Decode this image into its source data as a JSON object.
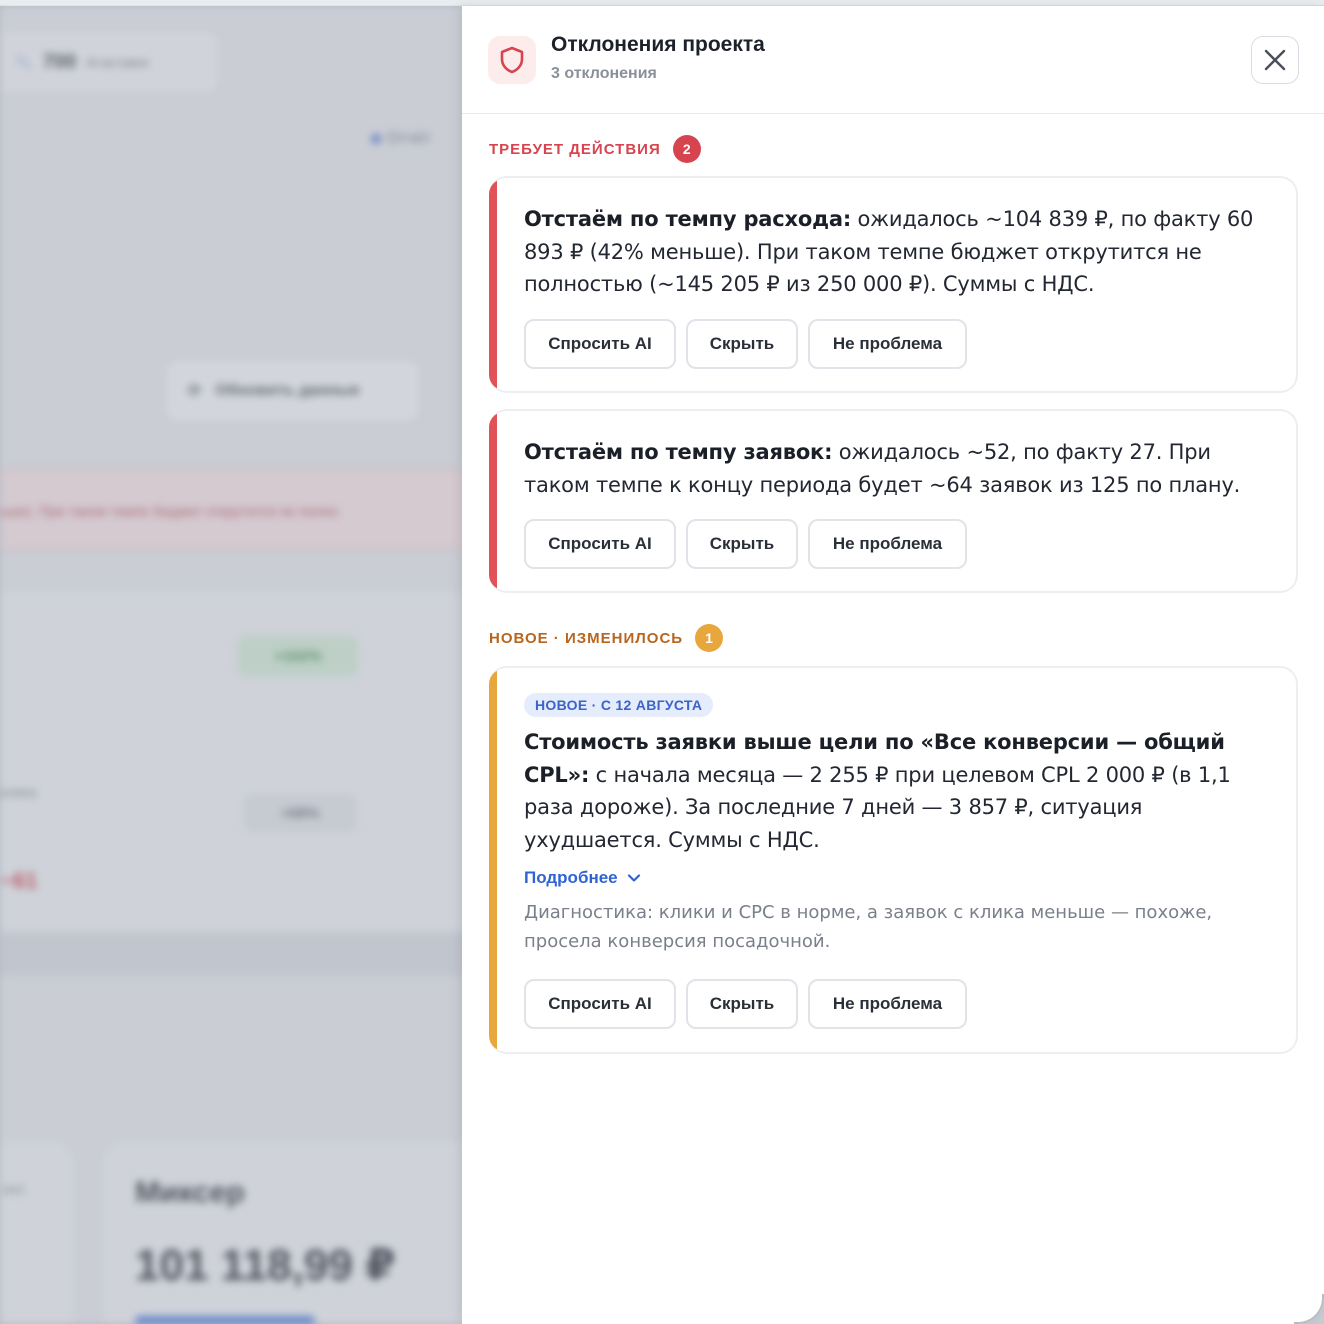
{
  "background": {
    "pill_number": "700",
    "pill_text": "AI-вставок",
    "report_text": "Отчёт",
    "refresh_label": "Обновить данные",
    "alert_text": "ьше). При таком темпе бюджет открутится не полно",
    "green_badge": "+102%",
    "grey_badge": "+68%",
    "small_text": "клика",
    "red_value": "−61",
    "card_sub": "ент.",
    "card_title": "Миксер",
    "card_amount": "101 118,99 ₽"
  },
  "drawer": {
    "title": "Отклонения проекта",
    "subtitle": "3 отклонения",
    "close_icon": "close-icon",
    "sections": [
      {
        "label": "ТРЕБУЕТ ДЕЙСТВИЯ",
        "count": "2",
        "color": "#d6454f"
      },
      {
        "label": "НОВОЕ · ИЗМЕНИЛОСЬ",
        "count": "1",
        "color": "#b8661f"
      }
    ],
    "cards": [
      {
        "bold": "Отстаём по темпу расхода:",
        "text": " ожидалось ~104 839 ₽, по факту 60 893 ₽ (42% меньше). При таком темпе бюджет открутится не полностью (~145 205 ₽ из 250 000 ₽). Суммы с НДС.",
        "stripe": "#e05258"
      },
      {
        "bold": "Отстаём по темпу заявок:",
        "text": " ожидалось ~52, по факту 27. При таком темпе к концу периода будет ~64 заявок из 125 по плану.",
        "stripe": "#e05258"
      },
      {
        "tag": "НОВОЕ · С 12 АВГУСТА",
        "bold": "Стоимость заявки выше цели по «Все конверсии — общий CPL»:",
        "text": " с начала месяца — 2 255 ₽ при целевом CPL 2 000 ₽ (в 1,1 раза дороже). За последние 7 дней — 3 857 ₽, ситуация ухудшается. Суммы с НДС.",
        "more": "Подробнее",
        "diagnostic": "Диагностика: клики и CPC в норме, а заявок с клика меньше — похоже, просела конверсия посадочной.",
        "stripe": "#e8a73c"
      }
    ],
    "buttons": {
      "ask_ai": "Спросить AI",
      "hide": "Скрыть",
      "not_problem": "Не проблема"
    }
  }
}
